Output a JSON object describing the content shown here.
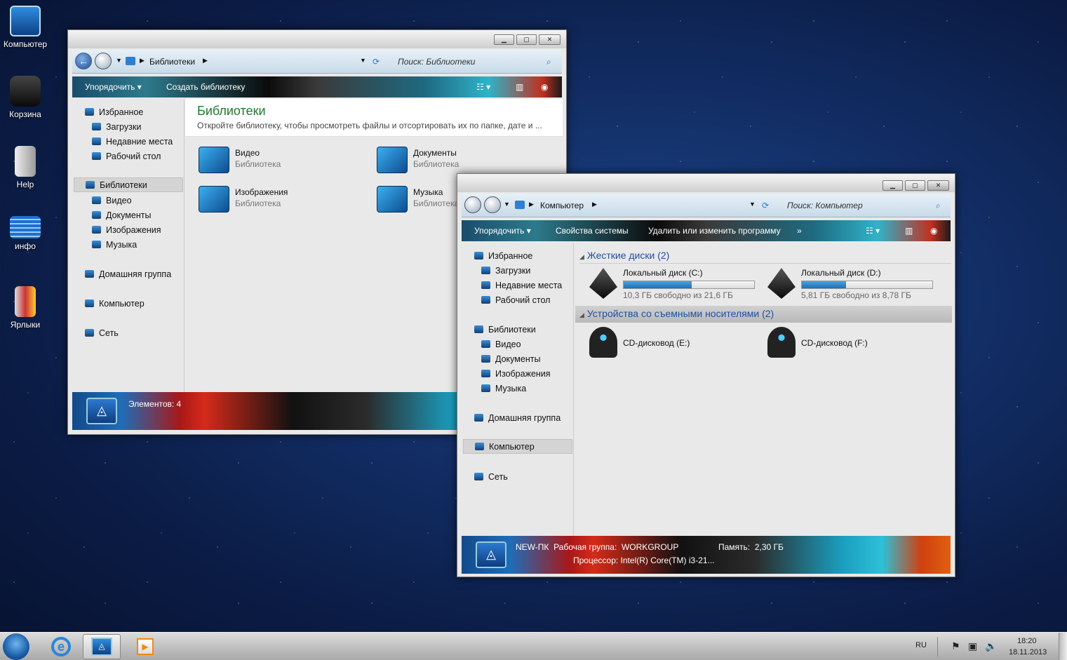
{
  "desktop": {
    "icons": [
      "Компьютер",
      "Корзина",
      "Help",
      "инфо",
      "Ярлыки"
    ]
  },
  "libwin": {
    "breadcrumb": "Библиотеки",
    "search_placeholder": "Поиск: Библиотеки",
    "toolbar": {
      "organize": "Упорядочить",
      "create_library": "Создать библиотеку"
    },
    "nav": {
      "favorites": "Избранное",
      "downloads": "Загрузки",
      "recent": "Недавние места",
      "desktop": "Рабочий стол",
      "libraries": "Библиотеки",
      "video": "Видео",
      "documents": "Документы",
      "images": "Изображения",
      "music": "Музыка",
      "homegroup": "Домашняя группа",
      "computer": "Компьютер",
      "network": "Сеть"
    },
    "header": {
      "title": "Библиотеки",
      "subtitle": "Откройте библиотеку, чтобы просмотреть файлы и отсортировать их по папке, дате и ..."
    },
    "items": [
      {
        "name": "Видео",
        "type": "Библиотека"
      },
      {
        "name": "Документы",
        "type": "Библиотека"
      },
      {
        "name": "Изображения",
        "type": "Библиотека"
      },
      {
        "name": "Музыка",
        "type": "Библиотека"
      }
    ],
    "status": "Элементов: 4"
  },
  "compwin": {
    "breadcrumb": "Компьютер",
    "search_placeholder": "Поиск: Компьютер",
    "toolbar": {
      "organize": "Упорядочить",
      "system_properties": "Свойства системы",
      "uninstall": "Удалить или изменить программу",
      "more": "»"
    },
    "nav": {
      "favorites": "Избранное",
      "downloads": "Загрузки",
      "recent": "Недавние места",
      "desktop": "Рабочий стол",
      "libraries": "Библиотеки",
      "video": "Видео",
      "documents": "Документы",
      "images": "Изображения",
      "music": "Музыка",
      "homegroup": "Домашняя группа",
      "computer": "Компьютер",
      "network": "Сеть"
    },
    "groups": {
      "hard_drives": "Жесткие диски (2)",
      "removable": "Устройства со съемными носителями (2)"
    },
    "drives": [
      {
        "name": "Локальный диск (C:)",
        "free": "10,3 ГБ свободно из 21,6 ГБ",
        "used_fraction": 0.52
      },
      {
        "name": "Локальный диск (D:)",
        "free": "5,81 ГБ свободно из 8,78 ГБ",
        "used_fraction": 0.34
      }
    ],
    "cds": [
      {
        "name": "CD-дисковод (E:)"
      },
      {
        "name": "CD-дисковод (F:)"
      }
    ],
    "status": {
      "pc": "NEW-ПК",
      "workgroup_label": "Рабочая группа:",
      "workgroup": "WORKGROUP",
      "memory_label": "Память:",
      "memory": "2,30 ГБ",
      "cpu_label": "Процессор:",
      "cpu": "Intel(R) Core(TM) i3-21..."
    }
  },
  "tray": {
    "lang": "RU",
    "time": "18:20",
    "date": "18.11.2013"
  }
}
